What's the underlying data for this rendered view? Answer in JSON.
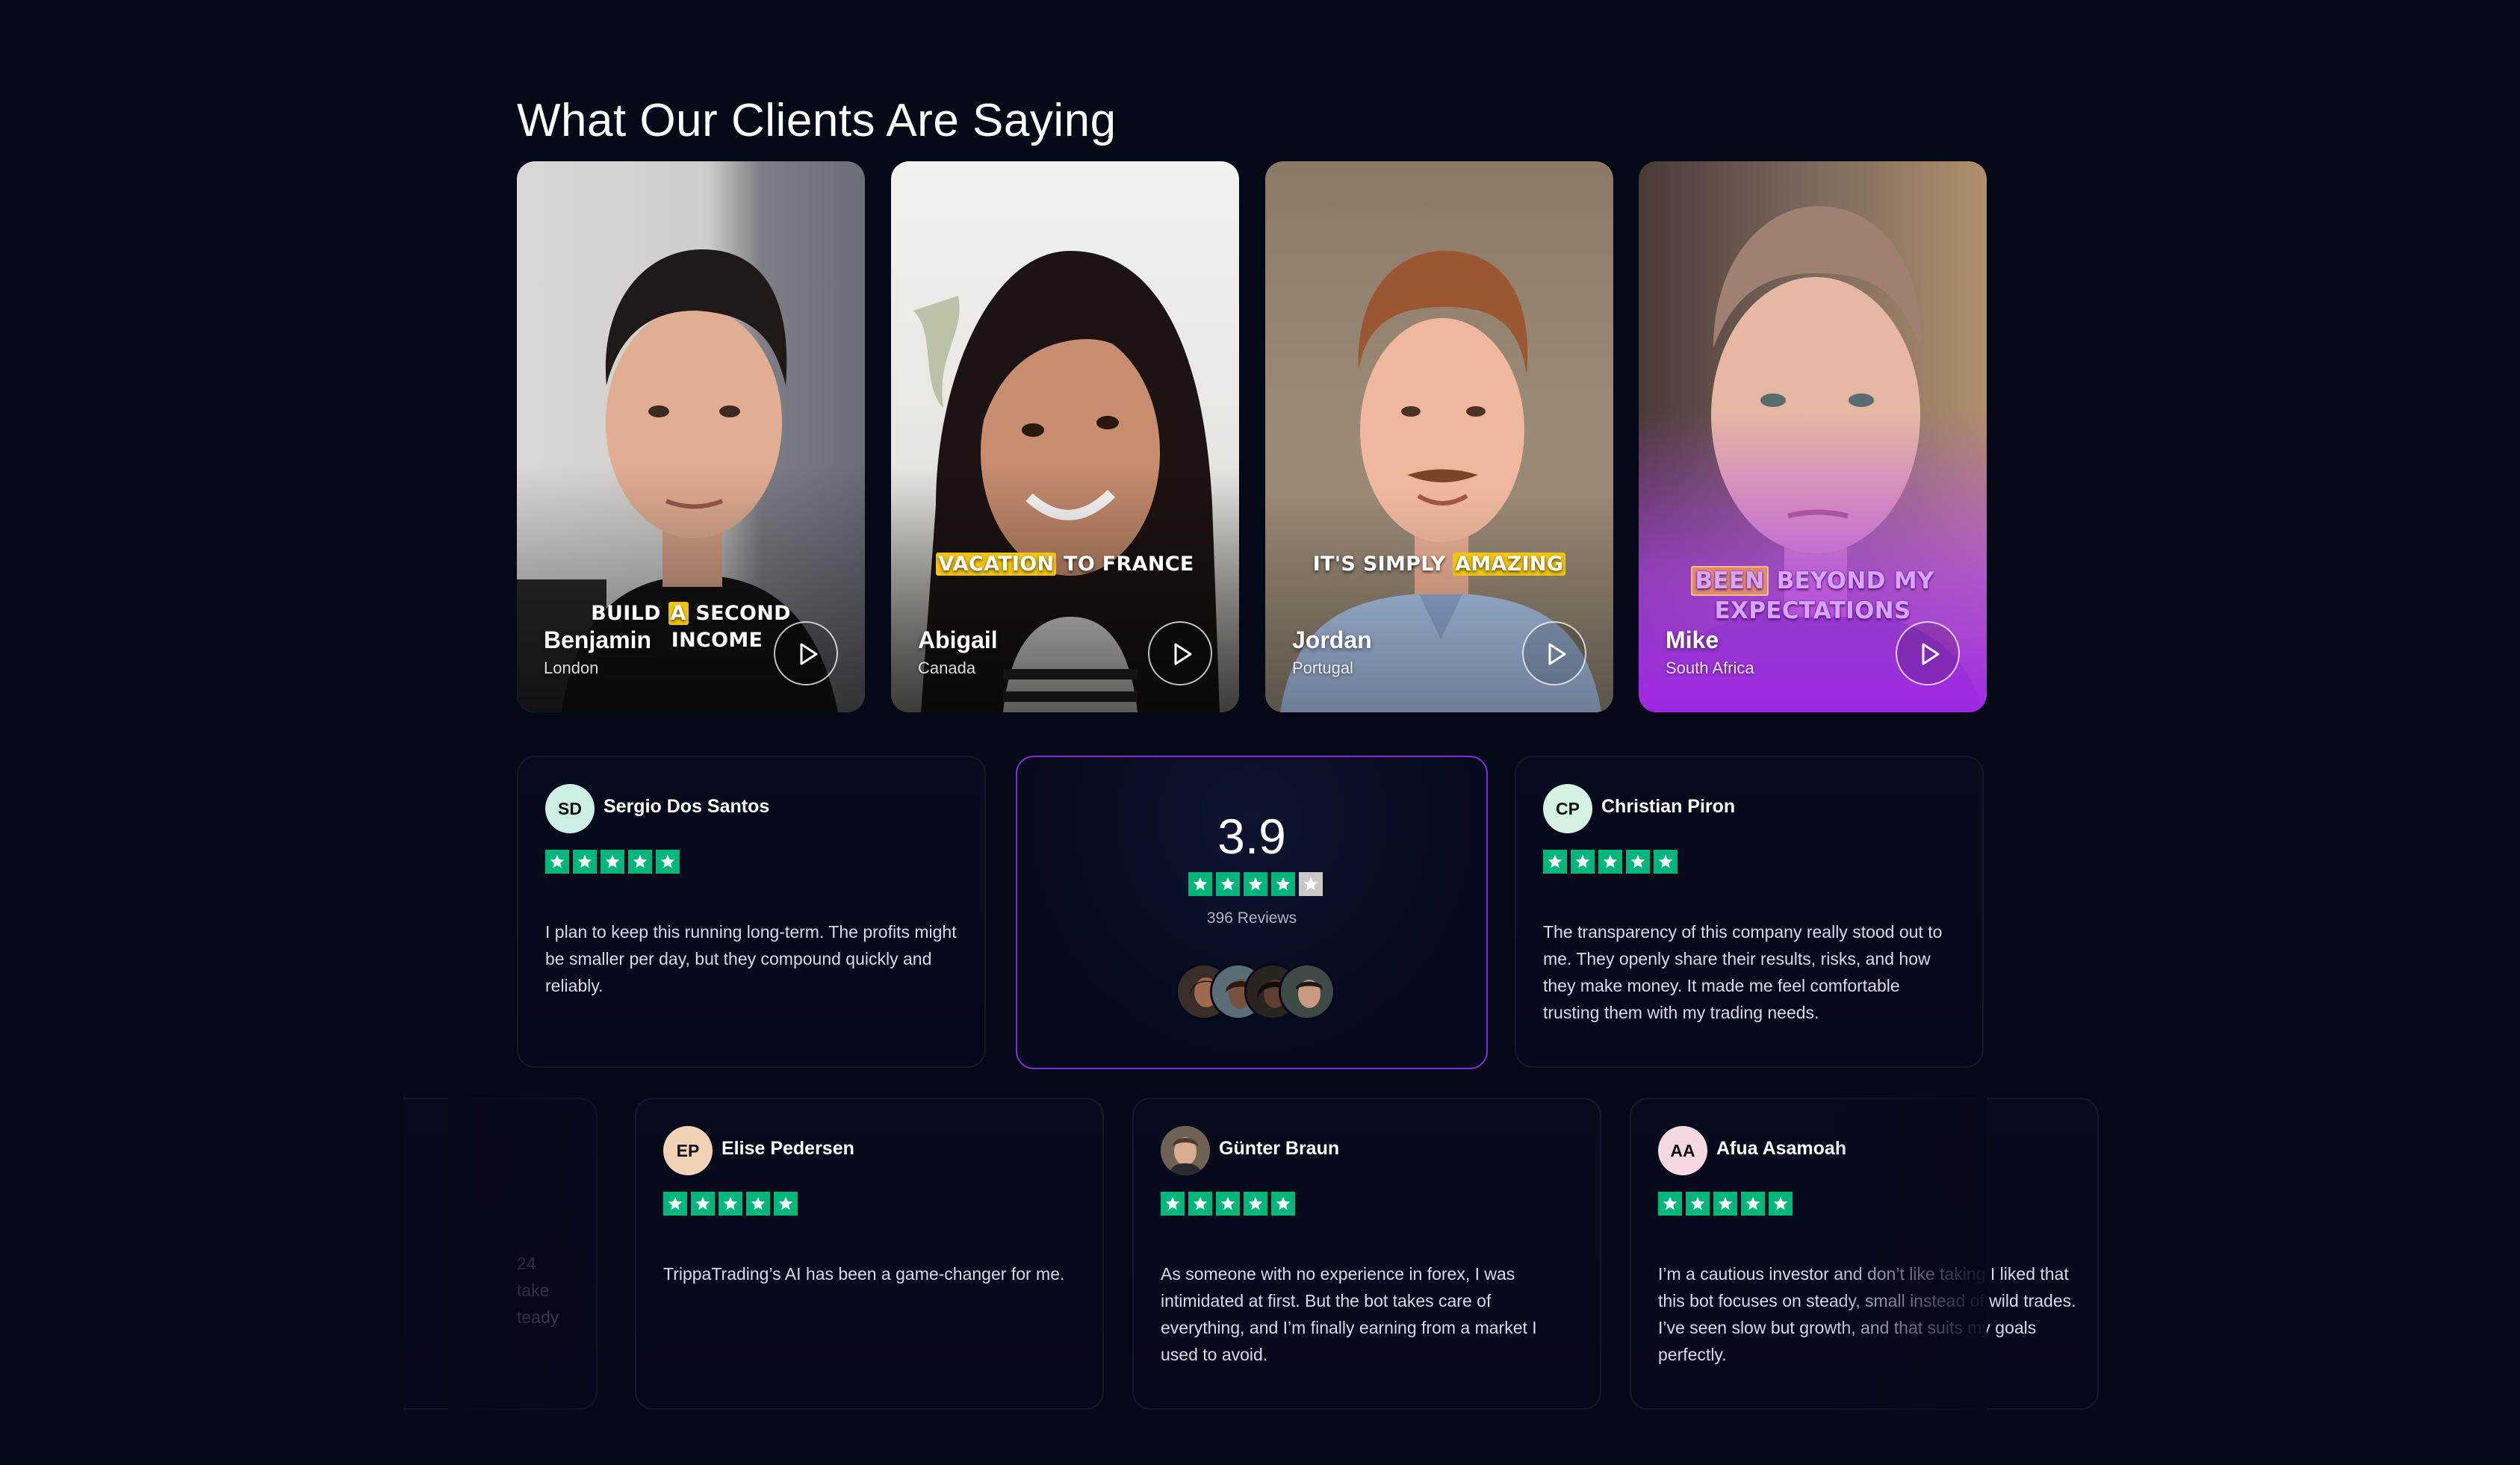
{
  "section": {
    "title": "What Our Clients Are Saying"
  },
  "videos": [
    {
      "name": "Benjamin",
      "location": "London",
      "caption_pre": "BUILD ",
      "caption_hl": "A",
      "caption_post": " SECOND",
      "caption_line2": "INCOME"
    },
    {
      "name": "Abigail",
      "location": "Canada",
      "caption_hl": "VACATION",
      "caption_post": " TO FRANCE"
    },
    {
      "name": "Jordan",
      "location": "Portugal",
      "caption_pre": "IT'S SIMPLY ",
      "caption_hl": "AMAZING"
    },
    {
      "name": "Mike",
      "location": "South Africa",
      "caption_hl": "BEEN",
      "caption_post": " BEYOND MY",
      "caption_line2": "EXPECTATIONS"
    }
  ],
  "rating": {
    "score": "3.9",
    "reviews_label": "396 Reviews",
    "stars_filled": 4,
    "stars_total": 5
  },
  "reviews_row1": [
    {
      "initials": "SD",
      "name": "Sergio Dos Santos",
      "text": "I plan to keep this running long-term. The profits might be smaller per day, but they compound quickly and reliably."
    },
    {
      "initials": "CP",
      "name": "Christian Piron",
      "text": "The transparency of this company really stood out to me. They openly share their results, risks, and how they make money. It made me feel comfortable trusting them with my trading needs."
    }
  ],
  "reviews_row2": [
    {
      "initials": "EP",
      "name": "Elise Pedersen",
      "text": "TrippaTrading’s AI has been a game-changer for me."
    },
    {
      "initials": "",
      "name": "Günter Braun",
      "text": "As someone with no experience in forex, I was intimidated at first. But the bot takes care of everything, and I’m finally earning from a market I used to avoid."
    },
    {
      "initials": "AA",
      "name": "Afua Asamoah",
      "text": "I’m a cautious investor and don’t like taking I liked that this bot focuses on steady, small instead of wild trades. I’ve seen slow but growth, and that suits my goals perfectly."
    }
  ],
  "partial_left_text": [
    "24",
    "take",
    "teady"
  ],
  "colors": {
    "background": "#050816",
    "accent_purple": "#7c2dd8",
    "trustpilot_green": "#00b67a",
    "caption_yellow": "#f1c40f"
  }
}
